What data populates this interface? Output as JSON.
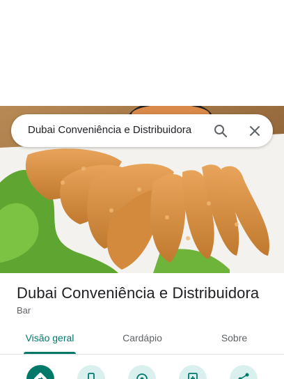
{
  "search": {
    "query": "Dubai Conveniência e Distribuidora"
  },
  "place": {
    "name": "Dubai Conveniência e Distribuidora",
    "category": "Bar"
  },
  "tabs": [
    {
      "label": "Visão geral",
      "active": true
    },
    {
      "label": "Cardápio",
      "active": false
    },
    {
      "label": "Sobre",
      "active": false
    }
  ],
  "actions": [
    {
      "icon": "directions-icon"
    },
    {
      "icon": "phone-icon"
    },
    {
      "icon": "location-icon"
    },
    {
      "icon": "save-icon"
    },
    {
      "icon": "share-icon"
    }
  ],
  "colors": {
    "accent": "#00796b",
    "action_tint": "#d9f0ee"
  }
}
